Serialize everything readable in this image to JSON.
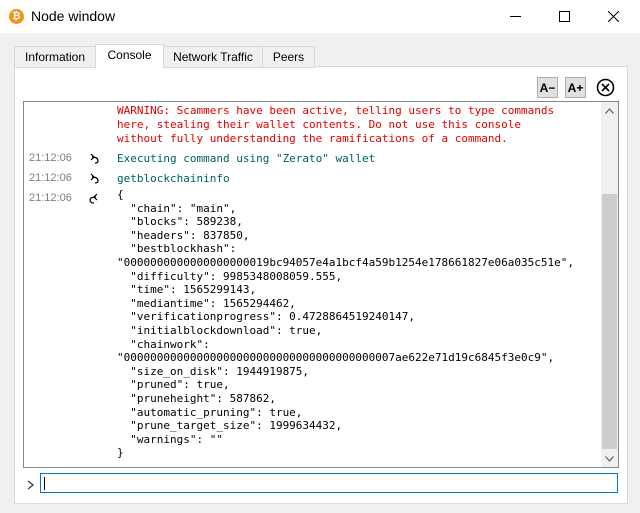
{
  "window": {
    "title": "Node window",
    "icon": "bitcoin-icon"
  },
  "tabs": [
    {
      "label": "Information"
    },
    {
      "label": "Console"
    },
    {
      "label": "Network Traffic"
    },
    {
      "label": "Peers"
    }
  ],
  "toolbar": {
    "font_smaller": "A−",
    "font_larger": "A+"
  },
  "console": {
    "warning": "WARNING: Scammers have been active, telling users to type commands\nhere, stealing their wallet contents. Do not use this console\nwithout fully understanding the ramifications of a command.",
    "entries": [
      {
        "time": "21:12:06",
        "icon": "command-arrow-icon",
        "text": "Executing command using \"Zerato\" wallet"
      },
      {
        "time": "21:12:06",
        "icon": "command-arrow-icon",
        "text": "getblockchaininfo"
      },
      {
        "time": "21:12:06",
        "icon": "reply-arrow-icon",
        "text": "{\n  \"chain\": \"main\",\n  \"blocks\": 589238,\n  \"headers\": 837850,\n  \"bestblockhash\":\n\"0000000000000000000019bc94057e4a1bcf4a59b1254e178661827e06a035c51e\",\n  \"difficulty\": 9985348008059.555,\n  \"time\": 1565299143,\n  \"mediantime\": 1565294462,\n  \"verificationprogress\": 0.4728864519240147,\n  \"initialblockdownload\": true,\n  \"chainwork\":\n\"00000000000000000000000000000000000000007ae622e71d19c6845f3e0c9\",\n  \"size_on_disk\": 1944919875,\n  \"pruned\": true,\n  \"pruneheight\": 587862,\n  \"automatic_pruning\": true,\n  \"prune_target_size\": 1999634432,\n  \"warnings\": \"\"\n}"
      }
    ]
  },
  "input": {
    "value": ""
  },
  "colors": {
    "warning": "#e00000",
    "command": "#006060",
    "timestamp": "#808080",
    "focus": "#0078d7",
    "bitcoin": "#f7931a"
  }
}
